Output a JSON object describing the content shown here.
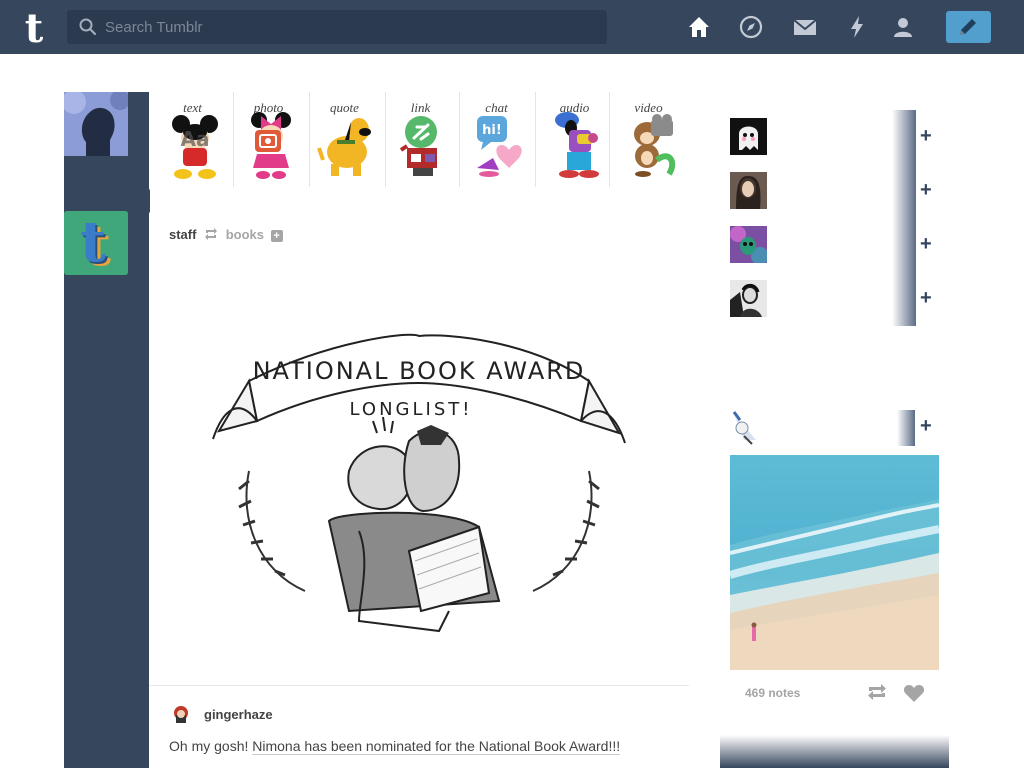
{
  "header": {
    "search_placeholder": "Search Tumblr",
    "nav": [
      "home-icon",
      "explore-icon",
      "inbox-icon",
      "activity-icon",
      "account-icon"
    ],
    "compose": "pencil-icon"
  },
  "post_types": [
    {
      "label": "text"
    },
    {
      "label": "photo"
    },
    {
      "label": "quote"
    },
    {
      "label": "link"
    },
    {
      "label": "chat"
    },
    {
      "label": "audio"
    },
    {
      "label": "video"
    }
  ],
  "post": {
    "blog": "staff",
    "source": "books",
    "reblogger": "gingerhaze",
    "text_prefix": "Oh my gosh! ",
    "text_link": "Nimona has been nominated for the National Book Award!!!",
    "illustration": {
      "banner": "NATIONAL BOOK AWARD",
      "sub": "LONGLIST!"
    }
  },
  "sidebar": {
    "recommended": [
      "ghost-avatar",
      "portrait-avatar",
      "purple-avatar",
      "bw-avatar"
    ],
    "plus": "+",
    "radar": {
      "plus": "+",
      "notes": "469 notes"
    }
  },
  "colors": {
    "navy": "#36465d",
    "search_bg": "#2c3a4f",
    "compose_blue": "#529ecc",
    "staff_green": "#3fa77a"
  }
}
